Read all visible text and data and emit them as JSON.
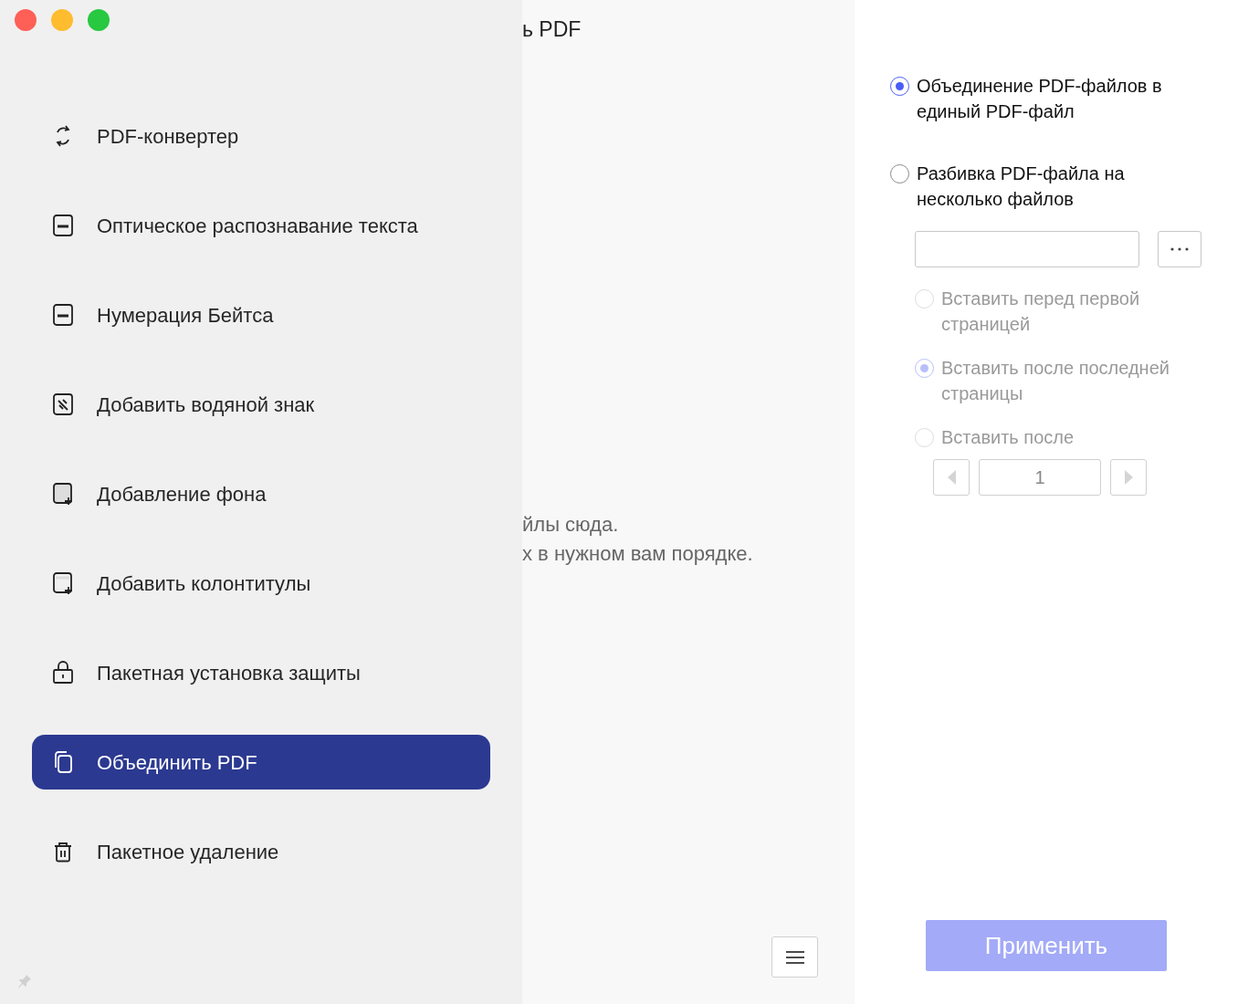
{
  "sidebar": {
    "items": [
      {
        "label": "PDF-конвертер",
        "selected": false
      },
      {
        "label": "Оптическое распознавание текста",
        "selected": false
      },
      {
        "label": "Нумерация Бейтса",
        "selected": false
      },
      {
        "label": "Добавить водяной знак",
        "selected": false
      },
      {
        "label": "Добавление фона",
        "selected": false
      },
      {
        "label": "Добавить колонтитулы",
        "selected": false
      },
      {
        "label": "Пакетная установка защиты",
        "selected": false
      },
      {
        "label": "Объединить PDF",
        "selected": true
      },
      {
        "label": "Пакетное удаление",
        "selected": false
      }
    ]
  },
  "main": {
    "title": "ь PDF",
    "hint_lines": [
      "йлы сюда.",
      "х в нужном вам порядке."
    ]
  },
  "options": [
    {
      "label": "Объединение PDF-файлов в единый PDF-файл",
      "selected": true,
      "disabled": false
    },
    {
      "label": "Разбивка PDF-файла на несколько файлов",
      "selected": false,
      "disabled": false
    }
  ],
  "insert_options": [
    {
      "label": "Вставить перед первой страницей",
      "selected": false,
      "disabled": true
    },
    {
      "label": "Вставить после последней страницы",
      "selected": true,
      "disabled": true
    },
    {
      "label": "Вставить после",
      "selected": false,
      "disabled": true
    }
  ],
  "page_stepper": {
    "value": "1"
  },
  "apply_button": {
    "label": "Применить",
    "disabled": true
  }
}
